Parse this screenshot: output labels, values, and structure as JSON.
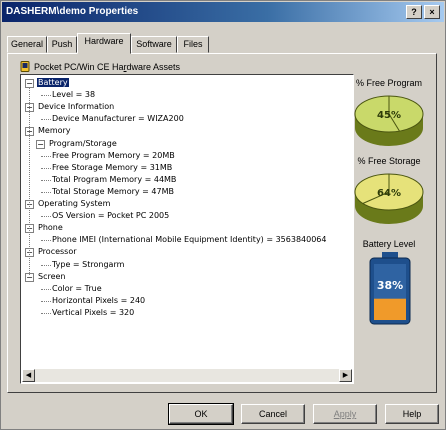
{
  "window": {
    "title": "DASHERM\\demo Properties",
    "help_glyph": "?",
    "close_glyph": "×"
  },
  "tabs": [
    {
      "label": "General"
    },
    {
      "label": "Push"
    },
    {
      "label": "Hardware"
    },
    {
      "label": "Software"
    },
    {
      "label": "Files"
    }
  ],
  "group": {
    "title_pre": "Pocket PC/Win CE Ha",
    "title_u": "r",
    "title_post": "dware Assets",
    "icon": "device-icon"
  },
  "tree": [
    {
      "label": "Battery",
      "expander": "−",
      "selected": true
    },
    {
      "label": "Level = 38"
    },
    {
      "label": "Device Information",
      "expander": "−"
    },
    {
      "label": "Device Manufacturer = WIZA200"
    },
    {
      "label": "Memory",
      "expander": "−"
    },
    {
      "label": "Program/Storage",
      "expander": "−"
    },
    {
      "label": "Free Program Memory = 20MB"
    },
    {
      "label": "Free Storage Memory = 31MB"
    },
    {
      "label": "Total Program Memory = 44MB"
    },
    {
      "label": "Total Storage Memory = 47MB"
    },
    {
      "label": "Operating System",
      "expander": "−"
    },
    {
      "label": "OS Version = Pocket PC 2005"
    },
    {
      "label": "Phone",
      "expander": "−"
    },
    {
      "label": "Phone IMEI (International Mobile Equipment Identity) = 3563840064"
    },
    {
      "label": "Processor",
      "expander": "−"
    },
    {
      "label": "Type = Strongarm"
    },
    {
      "label": "Screen",
      "expander": "−"
    },
    {
      "label": "Color = True"
    },
    {
      "label": "Horizontal Pixels = 240"
    },
    {
      "label": "Vertical Pixels = 320"
    }
  ],
  "scroll": {
    "left": "◀",
    "right": "▶"
  },
  "gauges": {
    "free_program": {
      "label": "% Free Program",
      "value_text": "45%",
      "value": 45,
      "color": "#c9d96a"
    },
    "free_storage": {
      "label": "% Free Storage",
      "value_text": "64%",
      "value": 64,
      "color": "#e6e27a"
    },
    "battery": {
      "label": "Battery Level",
      "value_text": "38%",
      "value": 38,
      "fill_color": "#f09a2a",
      "body_color": "#1e4f8c"
    }
  },
  "buttons": {
    "ok": "OK",
    "cancel": "Cancel",
    "apply": "Apply",
    "help": "Help"
  }
}
